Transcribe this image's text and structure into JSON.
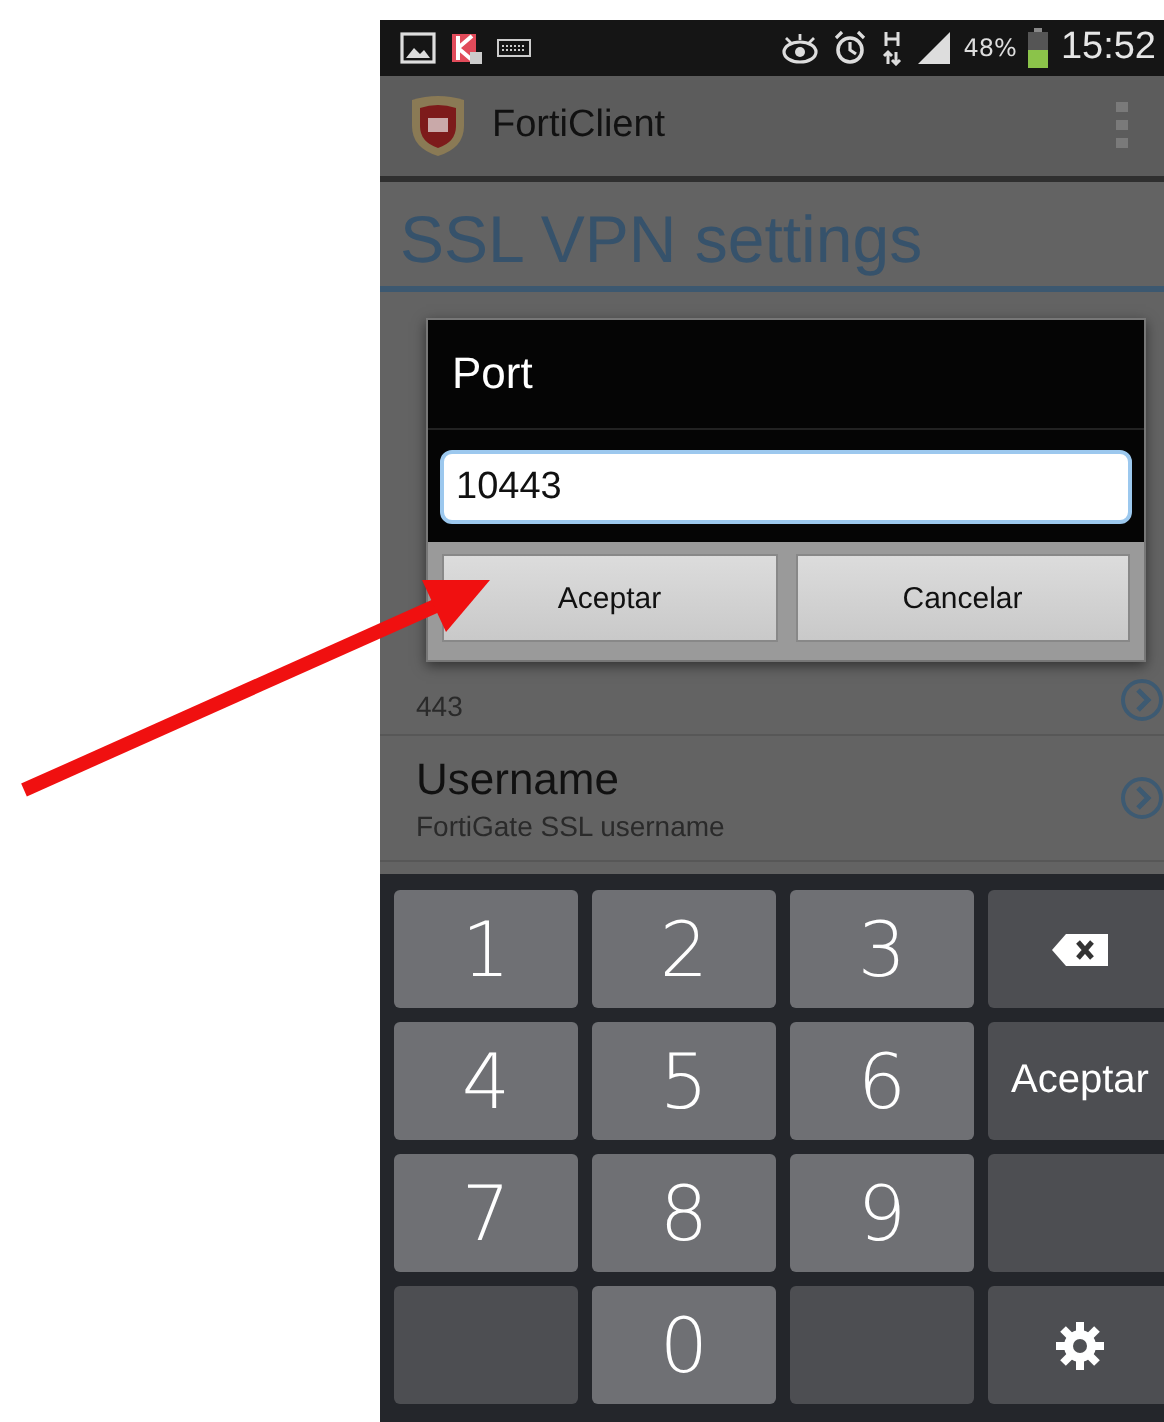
{
  "status_bar": {
    "battery": "48%",
    "time": "15:52"
  },
  "app_bar": {
    "title": "FortiClient"
  },
  "page_title": "SSL VPN settings",
  "settings": [
    {
      "subtitle": "443"
    },
    {
      "title": "Username",
      "subtitle": "FortiGate SSL username"
    }
  ],
  "dialog": {
    "title": "Port",
    "value": "10443",
    "buttons": [
      "Aceptar",
      "Cancelar"
    ]
  },
  "keyboard": [
    {
      "kind": "digit",
      "label": "1"
    },
    {
      "kind": "digit",
      "label": "2"
    },
    {
      "kind": "digit",
      "label": "3"
    },
    {
      "kind": "backspace"
    },
    {
      "kind": "digit",
      "label": "4"
    },
    {
      "kind": "digit",
      "label": "5"
    },
    {
      "kind": "digit",
      "label": "6"
    },
    {
      "kind": "action",
      "label": "Aceptar"
    },
    {
      "kind": "digit",
      "label": "7"
    },
    {
      "kind": "digit",
      "label": "8"
    },
    {
      "kind": "digit",
      "label": "9"
    },
    {
      "kind": "blank"
    },
    {
      "kind": "blank"
    },
    {
      "kind": "digit",
      "label": "0"
    },
    {
      "kind": "blank"
    },
    {
      "kind": "settings"
    }
  ]
}
